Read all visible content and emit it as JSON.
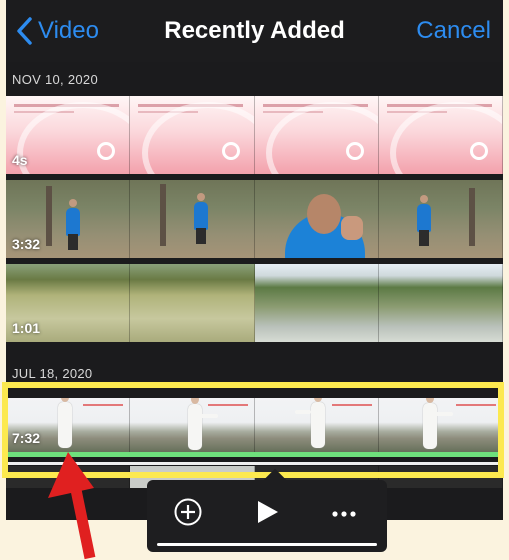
{
  "navbar": {
    "back_label": "Video",
    "title": "Recently Added",
    "cancel_label": "Cancel"
  },
  "sections": [
    {
      "date": "NOV 10, 2020"
    },
    {
      "date": "JUL 18, 2020"
    }
  ],
  "clips": [
    {
      "id": "clip1",
      "duration": "4s"
    },
    {
      "id": "clip2",
      "duration": "3:32"
    },
    {
      "id": "clip3",
      "duration": "1:01"
    },
    {
      "id": "clip4",
      "duration": "7:32"
    }
  ],
  "popup": {
    "icons": [
      "plus-circle-icon",
      "play-icon",
      "more-icon"
    ]
  },
  "colors": {
    "accent": "#2d8cf0",
    "highlight": "#fce94f",
    "arrow": "#e02020",
    "progress": "#6ee07c"
  }
}
